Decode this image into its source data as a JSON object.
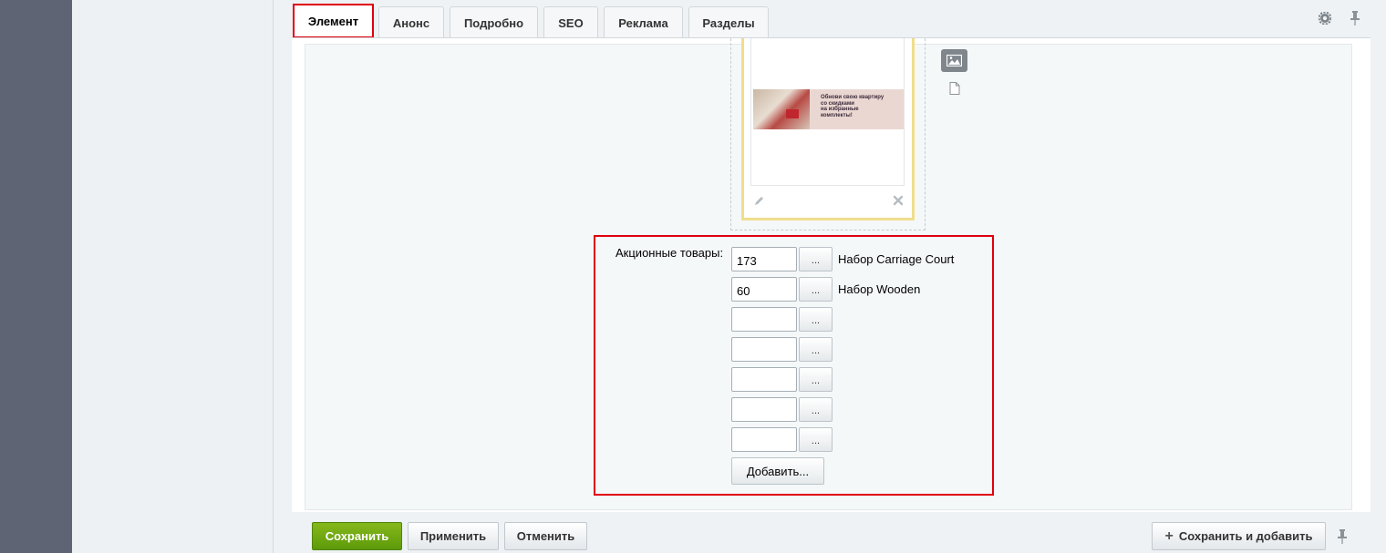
{
  "tabs": [
    {
      "label": "Элемент",
      "active": true
    },
    {
      "label": "Анонс",
      "active": false
    },
    {
      "label": "Подробно",
      "active": false
    },
    {
      "label": "SEO",
      "active": false
    },
    {
      "label": "Реклама",
      "active": false
    },
    {
      "label": "Разделы",
      "active": false
    }
  ],
  "toolbar_icons": [
    "gear-icon",
    "pin-icon"
  ],
  "image_field": {
    "banner_text": "Обнови свою квартиру\nсо скидками\nна избранные\nкомплекты!",
    "icons": [
      "edit-icon",
      "delete-icon",
      "image-type-icon",
      "file-type-icon"
    ]
  },
  "promo_products": {
    "label": "Акционные товары:",
    "rows": [
      {
        "value": "173",
        "name": "Набор Carriage Court"
      },
      {
        "value": "60",
        "name": "Набор Wooden"
      },
      {
        "value": "",
        "name": ""
      },
      {
        "value": "",
        "name": ""
      },
      {
        "value": "",
        "name": ""
      },
      {
        "value": "",
        "name": ""
      },
      {
        "value": "",
        "name": ""
      }
    ],
    "dots_label": "...",
    "add_label": "Добавить..."
  },
  "footer": {
    "save_label": "Сохранить",
    "apply_label": "Применить",
    "cancel_label": "Отменить",
    "save_add_label": "Сохранить и добавить",
    "save_add_icon": "plus-icon"
  },
  "colors": {
    "accent_red": "#e0000e",
    "save_green": "#6ea512",
    "sidebar_dark": "#5f6474"
  }
}
